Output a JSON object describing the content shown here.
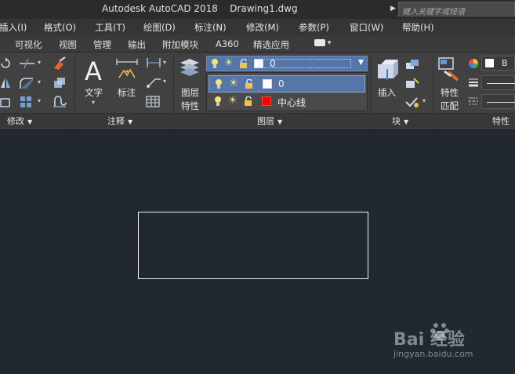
{
  "window": {
    "title": "Autodesk AutoCAD 2018    Drawing1.dwg",
    "search_placeholder": "键入关键字或短语"
  },
  "menu": [
    "插入(I)",
    "格式(O)",
    "工具(T)",
    "绘图(D)",
    "标注(N)",
    "修改(M)",
    "参数(P)",
    "窗口(W)",
    "帮助(H)"
  ],
  "tabs": [
    "可视化",
    "视图",
    "管理",
    "输出",
    "附加模块",
    "A360",
    "精选应用"
  ],
  "ribbon": {
    "panels": {
      "modify": "修改",
      "annotation": "注释",
      "layers": "图层",
      "block": "块",
      "properties": "特性"
    },
    "buttons": {
      "text": "文字",
      "dimension": "标注",
      "layer_properties_line1": "图层",
      "layer_properties_line2": "特性",
      "insert": "插入",
      "match_properties_line1": "特性",
      "match_properties_line2": "匹配",
      "color_swatch_label": "B"
    },
    "layer_combo": {
      "current": "0"
    },
    "layer_list": [
      {
        "name": "0",
        "color": "#ffffff",
        "selected": true
      },
      {
        "name": "中心线",
        "color": "#ff0000",
        "selected": false
      }
    ]
  },
  "watermark": {
    "brand": "Bai 经验",
    "url": "jingyan.baidu.com"
  },
  "colors": {
    "canvas": "#212830",
    "ribbon": "#414141",
    "selection": "#5476a8"
  }
}
